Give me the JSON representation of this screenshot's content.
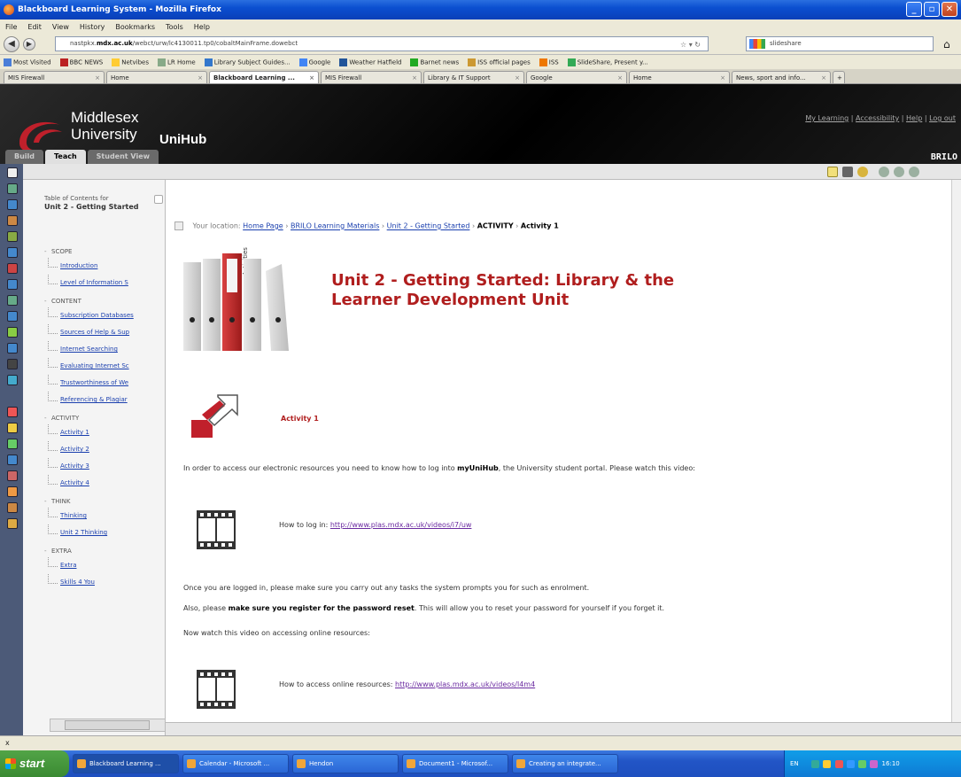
{
  "window": {
    "title": "Blackboard Learning System - Mozilla Firefox"
  },
  "menu": [
    "File",
    "Edit",
    "View",
    "History",
    "Bookmarks",
    "Tools",
    "Help"
  ],
  "navbar": {
    "url_prefix": "nastpkx.",
    "url_domain": "mdx.ac.uk",
    "url_rest": "/webct/urw/lc4130011.tp0/cobaltMainFrame.dowebct",
    "search_text": "slideshare"
  },
  "bookmarks": [
    "Most Visited",
    "BBC NEWS",
    "Netvibes",
    "LR Home",
    "Library Subject Guides...",
    "Google",
    "Weather Hatfield",
    "Barnet news",
    "ISS official pages",
    "ISS",
    "SlideShare, Present y..."
  ],
  "tabs": [
    {
      "label": "MIS Firewall",
      "active": false
    },
    {
      "label": "Home",
      "active": false
    },
    {
      "label": "Blackboard Learning ...",
      "active": true
    },
    {
      "label": "MIS Firewall",
      "active": false
    },
    {
      "label": "Library & IT Support",
      "active": false
    },
    {
      "label": "Google",
      "active": false
    },
    {
      "label": "Home",
      "active": false
    },
    {
      "label": "News, sport and info...",
      "active": false
    }
  ],
  "header": {
    "university": "Middlesex\nUniversity",
    "product": "UniHub",
    "links": [
      "My Learning",
      "Accessibility",
      "Help",
      "Log out"
    ],
    "mode_tabs": [
      "Build",
      "Teach",
      "Student View"
    ],
    "active_mode": "Teach",
    "course": "BRILO"
  },
  "toc": {
    "label": "Table of Contents for",
    "unit": "Unit 2 - Getting Started",
    "groups": [
      {
        "name": "SCOPE",
        "items": [
          "Introduction",
          "Level of Information S"
        ]
      },
      {
        "name": "CONTENT",
        "items": [
          "Subscription Databases",
          "Sources of Help & Sup",
          "Internet Searching",
          "Evaluating Internet Sc",
          "Trustworthiness of We",
          "Referencing & Plagiar"
        ]
      },
      {
        "name": "ACTIVITY",
        "items": [
          "Activity 1",
          "Activity 2",
          "Activity 3",
          "Activity 4"
        ]
      },
      {
        "name": "THINK",
        "items": [
          "Thinking",
          "Unit 2 Thinking"
        ]
      },
      {
        "name": "EXTRA",
        "items": [
          "Extra",
          "Skills 4 You"
        ]
      }
    ]
  },
  "breadcrumb": {
    "prefix": "Your location:",
    "links": [
      "Home Page",
      "BRILO Learning Materials",
      "Unit 2 - Getting Started"
    ],
    "section": "ACTIVITY",
    "current": "Activity 1"
  },
  "content": {
    "title_line1": "Unit 2 - Getting Started: Library & the",
    "title_line2": "Learner Development Unit",
    "binder_label": "Activities",
    "activity_label": "Activity 1",
    "intro_a": "In order to access our electronic resources you need to know how to log into ",
    "intro_bold": "myUniHub",
    "intro_b": ", the University student portal. Please watch this video:",
    "video1_label": "How to log in: ",
    "video1_link": "http://www.plas.mdx.ac.uk/videos/i7/uw",
    "after_login": "Once you are logged in, please make sure you carry out any tasks the system prompts you for such as enrolment.",
    "reset_a": "Also, please ",
    "reset_bold": "make sure you register for the password reset",
    "reset_b": ". This will allow you to reset your password for yourself if you forget it.",
    "watch_next": "Now watch this video on accessing online resources:",
    "video2_label": "How to access online resources: ",
    "video2_link": "http://www.plas.mdx.ac.uk/videos/l4m4"
  },
  "statusbar": {
    "text": "x"
  },
  "taskbar": {
    "start": "start",
    "tasks": [
      "Blackboard Learning ...",
      "Calendar - Microsoft ...",
      "Hendon",
      "Document1 - Microsof...",
      "Creating an integrate..."
    ],
    "active_task": "Blackboard Learning ...",
    "lang": "EN",
    "clock": "16:10"
  }
}
